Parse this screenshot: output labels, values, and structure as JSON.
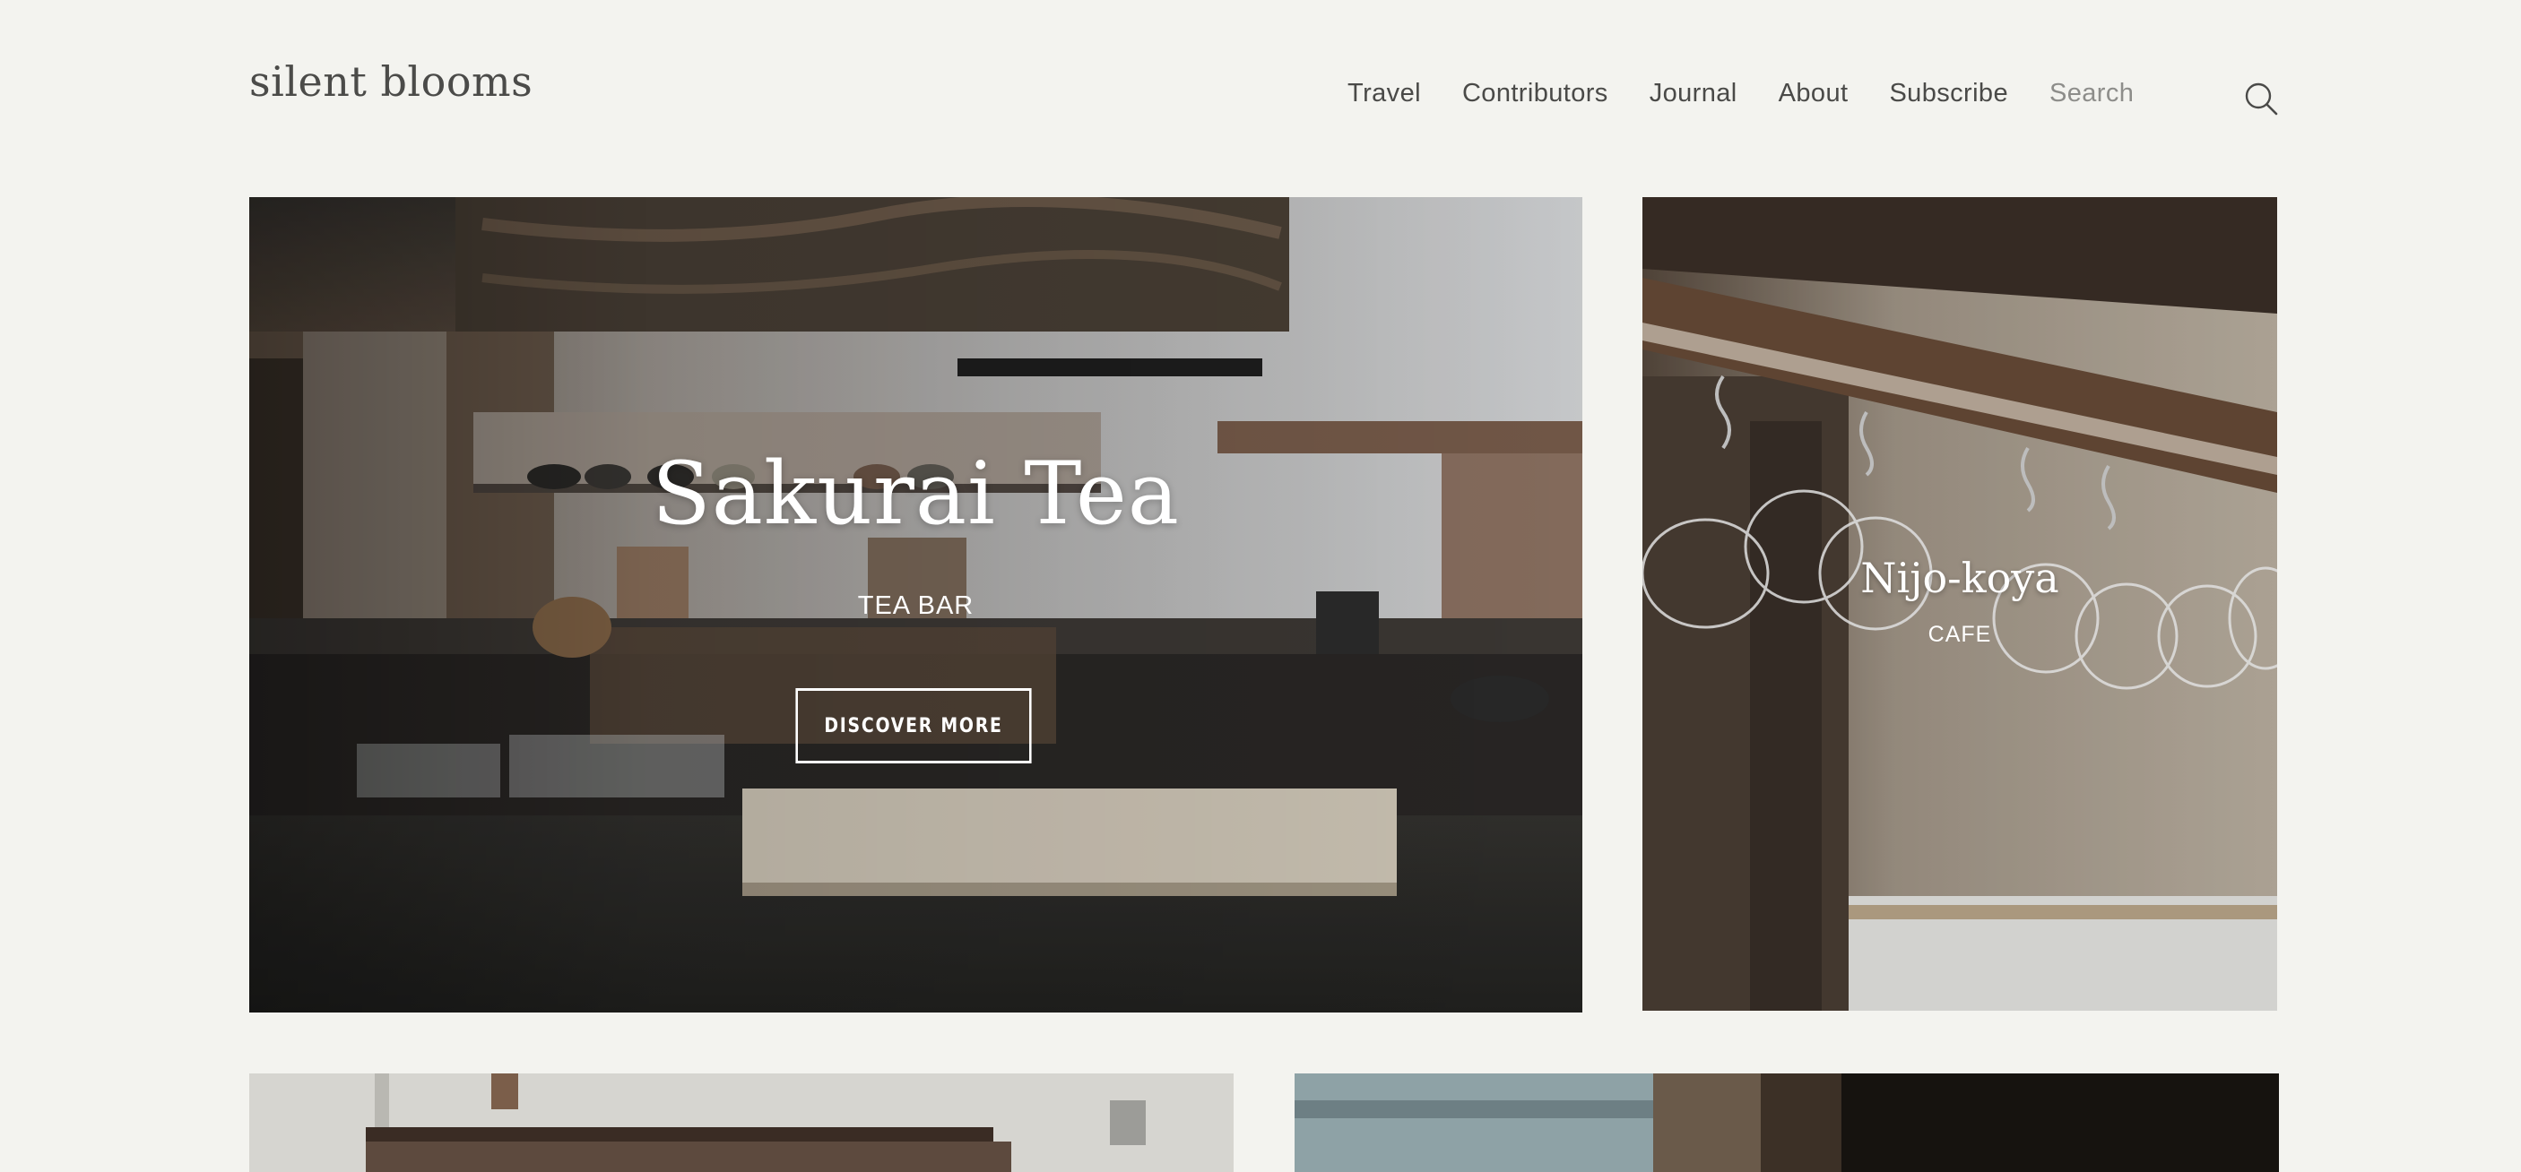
{
  "site": {
    "logo": "silent blooms"
  },
  "nav": {
    "items": [
      {
        "label": "Travel"
      },
      {
        "label": "Contributors"
      },
      {
        "label": "Journal"
      },
      {
        "label": "About"
      },
      {
        "label": "Subscribe"
      }
    ],
    "search": {
      "placeholder": "Search",
      "icon": "search-icon"
    }
  },
  "features": {
    "main": {
      "title": "Sakurai Tea",
      "category": "TEA BAR",
      "cta_label": "DISCOVER MORE"
    },
    "side": {
      "title": "Nijo-koya",
      "category": "CAFE"
    }
  },
  "colors": {
    "background": "#f3f3ef",
    "text": "#4a4a48",
    "overlay_text": "#ffffff"
  }
}
